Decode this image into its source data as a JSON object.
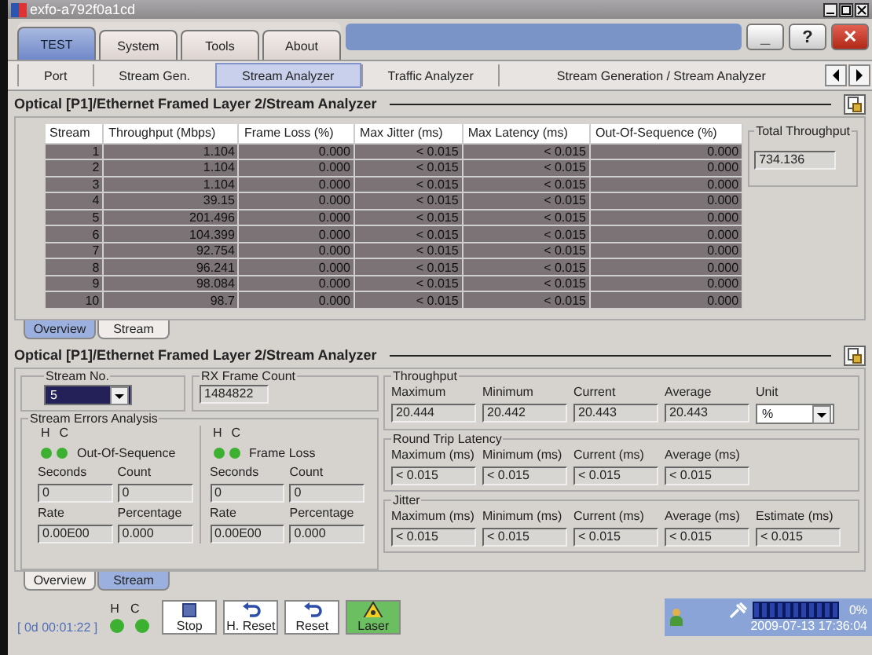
{
  "window": {
    "title": "exfo-a792f0a1cd"
  },
  "main_tabs": [
    {
      "label": "TEST",
      "selected": true
    },
    {
      "label": "System",
      "selected": false
    },
    {
      "label": "Tools",
      "selected": false
    },
    {
      "label": "About",
      "selected": false
    }
  ],
  "window_buttons": [
    {
      "kind": "minimize",
      "label": "_"
    },
    {
      "kind": "help",
      "label": "?"
    },
    {
      "kind": "close",
      "label": "✕"
    }
  ],
  "sub_tabs": [
    {
      "label": "Port",
      "selected": false
    },
    {
      "label": "Stream Gen.",
      "selected": false
    },
    {
      "label": "Stream Analyzer",
      "selected": true
    },
    {
      "label": "Traffic Analyzer",
      "selected": false
    },
    {
      "label": "Stream Generation / Stream Analyzer",
      "selected": false
    }
  ],
  "overview": {
    "title": "Optical [P1]/Ethernet Framed Layer 2/Stream Analyzer",
    "table": {
      "columns": [
        "Stream",
        "Throughput (Mbps)",
        "Frame Loss (%)",
        "Max Jitter (ms)",
        "Max Latency (ms)",
        "Out-Of-Sequence (%)"
      ],
      "rows": [
        [
          "1",
          "1.104",
          "0.000",
          "< 0.015",
          "< 0.015",
          "0.000"
        ],
        [
          "2",
          "1.104",
          "0.000",
          "< 0.015",
          "< 0.015",
          "0.000"
        ],
        [
          "3",
          "1.104",
          "0.000",
          "< 0.015",
          "< 0.015",
          "0.000"
        ],
        [
          "4",
          "39.15",
          "0.000",
          "< 0.015",
          "< 0.015",
          "0.000"
        ],
        [
          "5",
          "201.496",
          "0.000",
          "< 0.015",
          "< 0.015",
          "0.000"
        ],
        [
          "6",
          "104.399",
          "0.000",
          "< 0.015",
          "< 0.015",
          "0.000"
        ],
        [
          "7",
          "92.754",
          "0.000",
          "< 0.015",
          "< 0.015",
          "0.000"
        ],
        [
          "8",
          "96.241",
          "0.000",
          "< 0.015",
          "< 0.015",
          "0.000"
        ],
        [
          "9",
          "98.084",
          "0.000",
          "< 0.015",
          "< 0.015",
          "0.000"
        ],
        [
          "10",
          "98.7",
          "0.000",
          "< 0.015",
          "< 0.015",
          "0.000"
        ]
      ]
    },
    "total_throughput": {
      "label": "Total Throughput",
      "value": "734.136"
    },
    "view_tabs": [
      {
        "label": "Overview",
        "selected": true
      },
      {
        "label": "Stream",
        "selected": false
      }
    ]
  },
  "stream": {
    "title": "Optical [P1]/Ethernet Framed Layer 2/Stream Analyzer",
    "stream_no": {
      "label": "Stream No.",
      "value": "5"
    },
    "rx_frame_count": {
      "label": "RX Frame Count",
      "value": "1484822"
    },
    "errors": {
      "title": "Stream Errors Analysis",
      "groups": [
        {
          "h_label": "H",
          "c_label": "C",
          "h_on": true,
          "c_on": true,
          "name": "Out-Of-Sequence",
          "fields": [
            {
              "label": "Seconds",
              "value": "0"
            },
            {
              "label": "Count",
              "value": "0"
            },
            {
              "label": "Rate",
              "value": "0.00E00"
            },
            {
              "label": "Percentage",
              "value": "0.000"
            }
          ]
        },
        {
          "h_label": "H",
          "c_label": "C",
          "h_on": true,
          "c_on": true,
          "name": "Frame Loss",
          "fields": [
            {
              "label": "Seconds",
              "value": "0"
            },
            {
              "label": "Count",
              "value": "0"
            },
            {
              "label": "Rate",
              "value": "0.00E00"
            },
            {
              "label": "Percentage",
              "value": "0.000"
            }
          ]
        }
      ]
    },
    "throughput": {
      "title": "Throughput",
      "fields": [
        {
          "label": "Maximum",
          "value": "20.444"
        },
        {
          "label": "Minimum",
          "value": "20.442"
        },
        {
          "label": "Current",
          "value": "20.443"
        },
        {
          "label": "Average",
          "value": "20.443"
        }
      ],
      "unit": {
        "label": "Unit",
        "value": "%"
      }
    },
    "latency": {
      "title": "Round Trip Latency",
      "fields": [
        {
          "label": "Maximum (ms)",
          "value": "< 0.015"
        },
        {
          "label": "Minimum (ms)",
          "value": "< 0.015"
        },
        {
          "label": "Current (ms)",
          "value": "< 0.015"
        },
        {
          "label": "Average (ms)",
          "value": "< 0.015"
        }
      ]
    },
    "jitter": {
      "title": "Jitter",
      "fields": [
        {
          "label": "Maximum (ms)",
          "value": "< 0.015"
        },
        {
          "label": "Minimum (ms)",
          "value": "< 0.015"
        },
        {
          "label": "Current (ms)",
          "value": "< 0.015"
        },
        {
          "label": "Average (ms)",
          "value": "< 0.015"
        },
        {
          "label": "Estimate (ms)",
          "value": "< 0.015"
        }
      ]
    },
    "view_tabs": [
      {
        "label": "Overview",
        "selected": false
      },
      {
        "label": "Stream",
        "selected": true
      }
    ]
  },
  "status_bar": {
    "timer": "[ 0d 00:01:22 ]",
    "h_label": "H",
    "c_label": "C",
    "h_on": true,
    "c_on": true,
    "buttons": [
      {
        "kind": "stop",
        "label": "Stop",
        "on": false
      },
      {
        "kind": "reset",
        "label": "H. Reset",
        "on": false
      },
      {
        "kind": "reset",
        "label": "Reset",
        "on": false
      },
      {
        "kind": "laser",
        "label": "Laser",
        "on": true
      }
    ],
    "percent": "0%",
    "datetime": "2009-07-13 17:36:04"
  }
}
